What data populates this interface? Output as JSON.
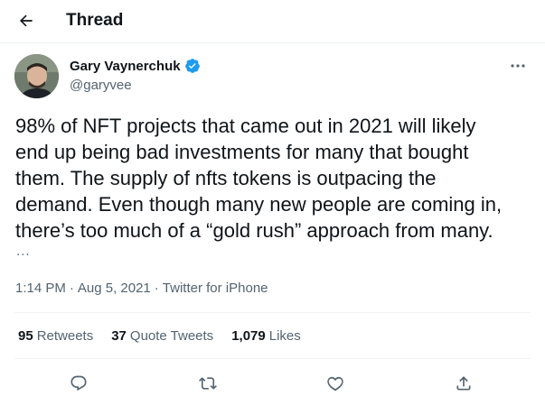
{
  "header": {
    "back_icon": "arrow-left-icon",
    "title": "Thread"
  },
  "author": {
    "name": "Gary Vaynerchuk",
    "handle": "@garyvee",
    "verified": true,
    "verified_icon": "verified-badge-icon"
  },
  "tweet": {
    "text": "98% of NFT projects that came out in 2021 will likely\nend up being bad investments for many that bought\nthem. The supply of nfts tokens is outpacing the\ndemand. Even though many new people are coming in,\nthere’s too much of a “gold rush” approach from many.",
    "truncation": "...",
    "time": "1:14 PM",
    "date": "Aug 5, 2021",
    "separator": "·",
    "source": "Twitter for iPhone"
  },
  "stats": {
    "retweets_count": "95",
    "retweets_label": "Retweets",
    "quote_count": "37",
    "quote_label": "Quote Tweets",
    "likes_count": "1,079",
    "likes_label": "Likes"
  },
  "actions": [
    "reply-icon",
    "retweet-icon",
    "like-icon",
    "share-icon"
  ],
  "colors": {
    "text": "#0f1419",
    "secondary": "#536471",
    "verified": "#1d9bf0",
    "divider": "#eff3f4",
    "background": "#ffffff"
  }
}
